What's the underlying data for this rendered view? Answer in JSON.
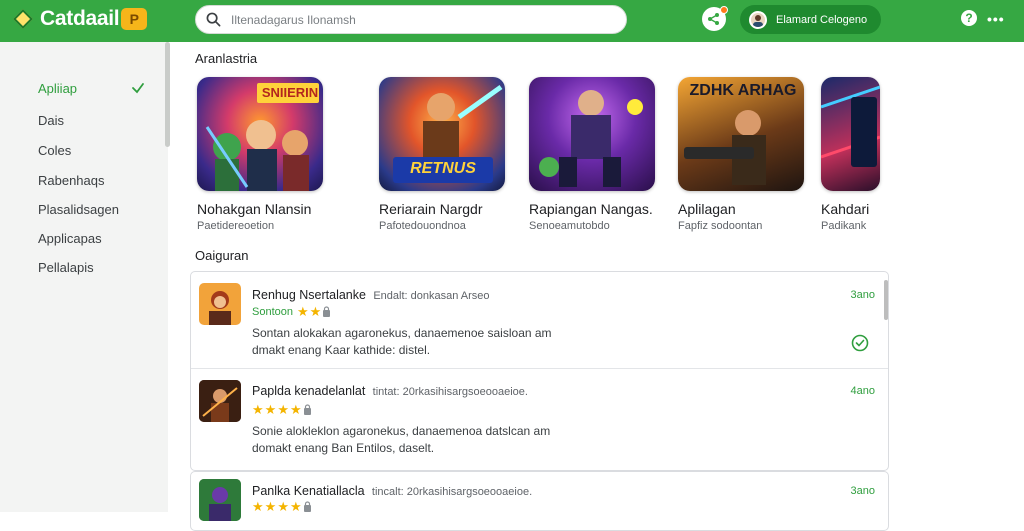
{
  "header": {
    "logo_text": "Catdaail",
    "logo_badge": "P",
    "search_placeholder": "Iltenadagarus Ilonamsh",
    "account_name": "Elamard Celogeno",
    "help_glyph": "?",
    "more_glyph": "•••"
  },
  "sidebar": {
    "items": [
      {
        "label": "Apliiap",
        "active": true
      },
      {
        "label": "Dais"
      },
      {
        "label": "Coles"
      },
      {
        "label": "Rabenhaqs"
      },
      {
        "label": "Plasalidsagen"
      },
      {
        "label": "Applicapas"
      },
      {
        "label": "Pellalapis"
      }
    ]
  },
  "featured": {
    "heading": "Aranlastria",
    "apps": [
      {
        "title": "Nohakgan Nlansin",
        "subtitle": "Paetidereoetion",
        "tile_text": "SNIIERIN",
        "icon": "game-icon"
      },
      {
        "title": "Reriarain Nargdr",
        "subtitle": "Pafotedouondnoa",
        "tile_text": "RETNUS",
        "icon": "game-icon"
      },
      {
        "title": "Rapiangan Nangas.",
        "subtitle": "Senoeamutobdo",
        "tile_text": "",
        "icon": "game-icon"
      },
      {
        "title": "Aplilagan",
        "subtitle": "Fapfiz sodoontan",
        "tile_text": "ZDHK ARHAG",
        "icon": "game-icon"
      },
      {
        "title": "Kahdari",
        "subtitle": "Padikank",
        "tile_text": "",
        "icon": "game-icon"
      }
    ]
  },
  "reviews": {
    "heading": "Oaiguran",
    "items": [
      {
        "app": "Renhug Nsertalanke",
        "meta": "Endalt: donkasan Arseo",
        "rating_label": "Sontoon",
        "stars": 2,
        "body_line1": "Sontan alokakan agaronekus, danaemenoe saisloan am",
        "body_line2": "dmakt enang Kaar kathide: distel.",
        "time": "3ano"
      },
      {
        "app": "Paplda kenadelanlat",
        "meta": "tintat: 20rkasihisargsoeooaeioe.",
        "rating_label": "",
        "stars": 4,
        "body_line1": "Sonie alokleklon agaronekus, danaemenoa datslcan am",
        "body_line2": "domakt enang Ban Entilos, daselt.",
        "time": "4ano"
      },
      {
        "app": "Panlka Kenatiallacla",
        "meta": "tincalt: 20rkasihisargsoeooaeioe.",
        "rating_label": "",
        "stars": 4,
        "body_line1": "",
        "body_line2": "",
        "time": "3ano"
      }
    ]
  },
  "colors": {
    "brand_green": "#36a843",
    "accent_green": "#2f9e3e",
    "star": "#f4b400"
  }
}
